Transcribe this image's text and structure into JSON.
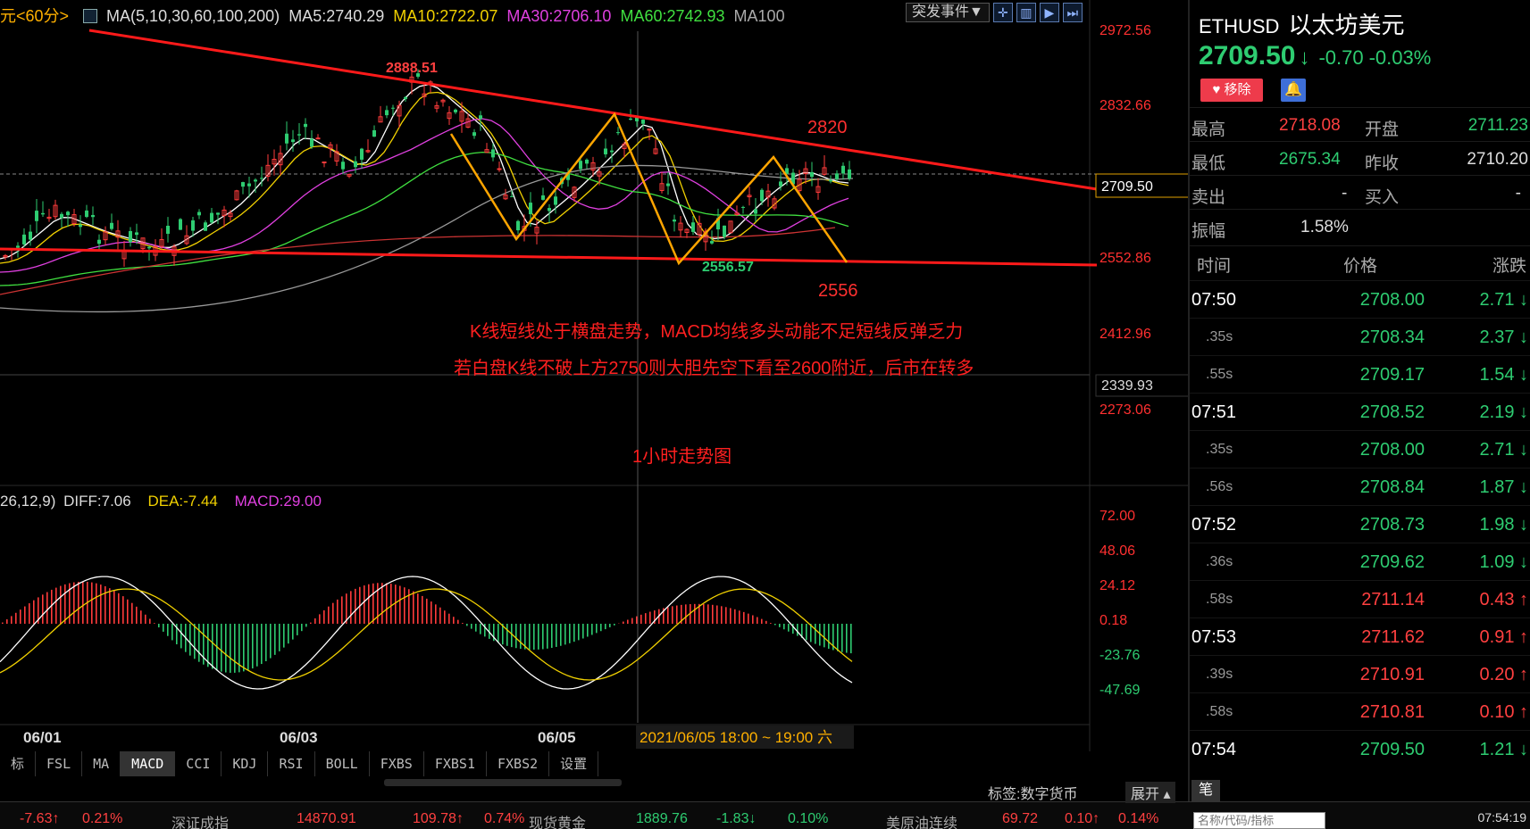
{
  "header": {
    "period_label": "元<60分>",
    "ma_label": "MA(5,10,30,60,100,200)",
    "ma5": "MA5:2740.29",
    "ma10": "MA10:2722.07",
    "ma30": "MA30:2706.10",
    "ma60": "MA60:2742.93",
    "ma100": "MA100",
    "event_button": "突发事件▼",
    "colors": {
      "ma5": "#ffffff",
      "ma10": "#f0d000",
      "ma30": "#e040e0",
      "ma60": "#40e040",
      "ma100": "#aaaaaa"
    }
  },
  "price_axis": {
    "ticks": [
      "2972.56",
      "2832.66",
      "2709.50",
      "2552.86",
      "2412.96",
      "2339.93",
      "2273.06"
    ],
    "current_box": "2709.50",
    "low_box": "2339.93"
  },
  "annotations": {
    "high_label": "2888.51",
    "low_label": "2556.57",
    "target_high": "2820",
    "target_low": "2556",
    "comment_line1": "K线短线处于横盘走势，MACD均线多头动能不足短线反弹乏力",
    "comment_line2": "若白盘K线不破上方2750则大胆先空下看至2600附近，后市在转多",
    "chart_caption": "1小时走势图"
  },
  "macd": {
    "label_params": "26,12,9)",
    "diff": "DIFF:7.06",
    "dea": "DEA:-7.44",
    "macd": "MACD:29.00",
    "axis_ticks": [
      "72.00",
      "48.06",
      "24.12",
      "0.18",
      "-23.76",
      "-47.69"
    ]
  },
  "time_axis": {
    "labels": [
      "06/01",
      "06/03",
      "06/05"
    ],
    "cursor_label": "2021/06/05 18:00 ~ 19:00 六"
  },
  "bottom_tabs": [
    "标",
    "FSL",
    "MA",
    "MACD",
    "CCI",
    "KDJ",
    "RSI",
    "BOLL",
    "FXBS",
    "FXBS1",
    "FXBS2",
    "设置"
  ],
  "status_strip": {
    "items": [
      {
        "text": "-7.63↑",
        "dir": "up"
      },
      {
        "text": "0.21%",
        "dir": "up"
      },
      {
        "text": "深证成指",
        "dir": "lbl"
      },
      {
        "text": "14870.91",
        "dir": "up"
      },
      {
        "text": "109.78↑",
        "dir": "up"
      },
      {
        "text": "0.74%",
        "dir": "up"
      },
      {
        "text": "现货黄金",
        "dir": "lbl"
      },
      {
        "text": "1889.76",
        "dir": "dn"
      },
      {
        "text": "-1.83↓",
        "dir": "dn"
      },
      {
        "text": "0.10%",
        "dir": "dn"
      },
      {
        "text": "美原油连续",
        "dir": "lbl"
      },
      {
        "text": "69.72",
        "dir": "up"
      },
      {
        "text": "0.10↑",
        "dir": "up"
      },
      {
        "text": "0.14%",
        "dir": "up"
      }
    ],
    "tag_label": "标签:数字货币",
    "expand": "展开 ▴",
    "pen": "笔",
    "search_placeholder": "名称/代码/指标",
    "clock": "07:54:19"
  },
  "quote": {
    "symbol": "ETHUSD",
    "name": "以太坊美元",
    "price": "2709.50",
    "arrow": "↓",
    "change": "-0.70",
    "change_pct": "-0.03%",
    "remove_label": "移除",
    "high_label": "最高",
    "high": "2718.08",
    "open_label": "开盘",
    "open": "2711.23",
    "low_label": "最低",
    "low": "2675.34",
    "prev_label": "昨收",
    "prev": "2710.20",
    "sell_label": "卖出",
    "sell": "-",
    "buy_label": "买入",
    "buy": "-",
    "amp_label": "振幅",
    "amp": "1.58%",
    "tick_headers": [
      "时间",
      "价格",
      "涨跌"
    ],
    "ticks": [
      {
        "time": "07:50",
        "sub": false,
        "price": "2708.00",
        "chg": "2.71",
        "dir": "dn"
      },
      {
        "time": ".35s",
        "sub": true,
        "price": "2708.34",
        "chg": "2.37",
        "dir": "dn"
      },
      {
        "time": ".55s",
        "sub": true,
        "price": "2709.17",
        "chg": "1.54",
        "dir": "dn"
      },
      {
        "time": "07:51",
        "sub": false,
        "price": "2708.52",
        "chg": "2.19",
        "dir": "dn"
      },
      {
        "time": ".35s",
        "sub": true,
        "price": "2708.00",
        "chg": "2.71",
        "dir": "dn"
      },
      {
        "time": ".56s",
        "sub": true,
        "price": "2708.84",
        "chg": "1.87",
        "dir": "dn"
      },
      {
        "time": "07:52",
        "sub": false,
        "price": "2708.73",
        "chg": "1.98",
        "dir": "dn"
      },
      {
        "time": ".36s",
        "sub": true,
        "price": "2709.62",
        "chg": "1.09",
        "dir": "dn"
      },
      {
        "time": ".58s",
        "sub": true,
        "price": "2711.14",
        "chg": "0.43",
        "dir": "up"
      },
      {
        "time": "07:53",
        "sub": false,
        "price": "2711.62",
        "chg": "0.91",
        "dir": "up"
      },
      {
        "time": ".39s",
        "sub": true,
        "price": "2710.91",
        "chg": "0.20",
        "dir": "up"
      },
      {
        "time": ".58s",
        "sub": true,
        "price": "2710.81",
        "chg": "0.10",
        "dir": "up"
      },
      {
        "time": "07:54",
        "sub": false,
        "price": "2709.50",
        "chg": "1.21",
        "dir": "dn"
      }
    ]
  }
}
